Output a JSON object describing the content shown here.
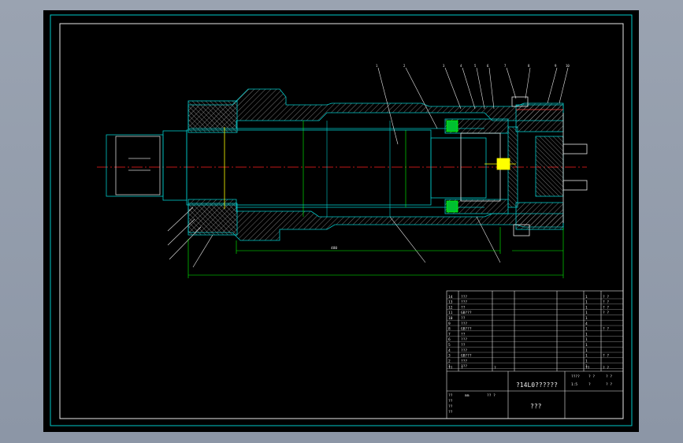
{
  "drawing": {
    "title": "?14L0??????",
    "subtitle": "???",
    "dimensions": {
      "center_gap": "480"
    },
    "title_block": {
      "rows": [
        [
          "14",
          "???",
          "",
          "1",
          "? ?"
        ],
        [
          "13",
          "???",
          "",
          "1",
          "? ?"
        ],
        [
          "12",
          "??",
          "",
          "1",
          "? ?"
        ],
        [
          "11",
          "GB???",
          "",
          "1",
          "? ?"
        ],
        [
          "10",
          "??",
          "",
          "1",
          ""
        ],
        [
          "9",
          "???",
          "",
          "4",
          ""
        ],
        [
          "8",
          "GB???",
          "",
          "1",
          "? ?"
        ],
        [
          "7",
          "??",
          "",
          "1",
          ""
        ],
        [
          "6",
          "???",
          "",
          "1",
          ""
        ],
        [
          "5",
          "??",
          "",
          "1",
          ""
        ],
        [
          "4",
          "???",
          "",
          "1",
          ""
        ],
        [
          "3",
          "GB???",
          "",
          "1",
          "? ?"
        ],
        [
          "2",
          "???",
          "",
          "1",
          ""
        ],
        [
          "1",
          "???",
          "",
          "1",
          ""
        ]
      ],
      "header": [
        "??",
        "?",
        "?",
        "??",
        "? ?"
      ],
      "sign_rows": [
        "??",
        "??",
        "??",
        "??"
      ],
      "sign_cols": [
        "mm",
        "?? ?"
      ],
      "right_labels": [
        "????",
        "? ?",
        "? ?",
        "1:5",
        "?",
        "? ?"
      ]
    }
  },
  "colors": {
    "background": "#000000",
    "frame": "#00c8c8",
    "section": "#00c8c8",
    "hatch": "#b0b0b0",
    "dimension": "#00ff00",
    "centerline": "#ff2020",
    "highlight": "#ffff00",
    "leader": "#ffffff"
  }
}
